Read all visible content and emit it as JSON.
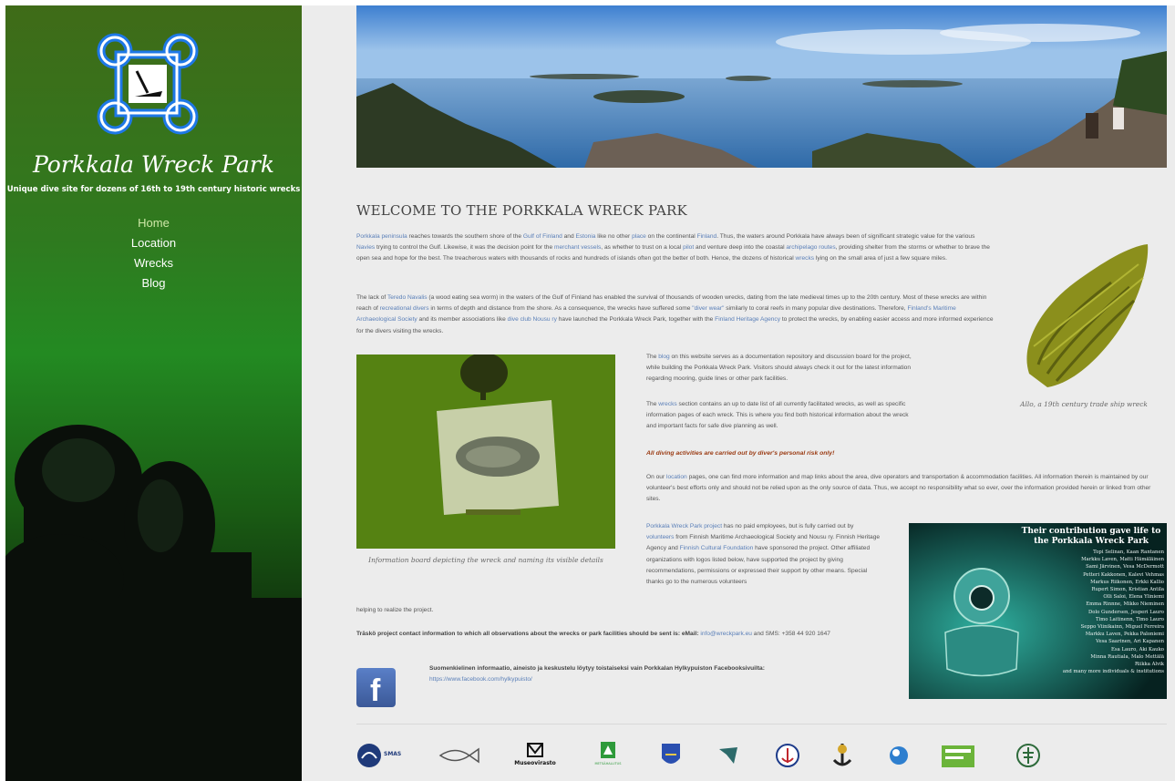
{
  "site": {
    "title": "Porkkala Wreck Park",
    "tagline": "Unique dive site for dozens of 16th to 19th century historic wrecks"
  },
  "nav": {
    "items": [
      {
        "label": "Home"
      },
      {
        "label": "Location"
      },
      {
        "label": "Wrecks"
      },
      {
        "label": "Blog"
      }
    ]
  },
  "main": {
    "heading": "WELCOME TO THE PORKKALA WRECK PARK",
    "p1": {
      "link1": "Porkkala peninsula",
      "t1": " reaches towards the southern shore of the ",
      "link2": "Gulf of Finland",
      "t2": " and ",
      "link3": "Estonia",
      "t3": " like no other ",
      "link4": "place",
      "t4": " on the continental ",
      "link5": "Finland",
      "t5": ". Thus, the waters around Porkkala have always been of significant strategic value for the various ",
      "link6": "Navies",
      "t6": " trying to control the Gulf. Likewise, it was the decision point for the ",
      "link7": "merchant vessels",
      "t7": ", as whether to trust on a local ",
      "link8": "pilot",
      "t8": " and venture deep into the coastal ",
      "link9": "archipelago routes",
      "t9": ", providing shelter from the storms or whether to brave the open sea and hope for the best. The treacherous waters with thousands of rocks and hundreds of islands often got the better of both. Hence, the dozens of historical ",
      "link10": "wrecks",
      "t10": " lying on the small area of just a few square miles."
    },
    "p2": {
      "t0": "The lack of ",
      "link1": "Teredo Navalis",
      "t1": " (a wood eating sea worm) in the waters of the Gulf of Finland has enabled the survival of thousands of wooden wrecks, dating from the late medieval times up to the 20th century. Most of these wrecks are within reach of ",
      "link2": "recreational divers",
      "t2": " in terms of depth and distance from the shore. As a consequence, the wrecks have suffered some ",
      "link3": "\"diver wear\"",
      "t3": " similarly to coral reefs in many popular dive destinations. Therefore, ",
      "link4": "Finland's Maritime Archaeological Society",
      "t4": " and its member associations like ",
      "link5": "dive club Nousu ry",
      "t5": " have launched the Porkkala Wreck Park, together with the ",
      "link6": "Finland Heritage Agency",
      "t6": " to protect the wrecks, by enabling easier access and more informed experience for the divers visiting the wrecks."
    },
    "ship_caption": "Allo, a 19th century trade ship wreck",
    "board_caption": "Information board depicting the wreck and naming its visible details",
    "p3": {
      "t0": "The ",
      "link1": "blog",
      "t1": " on this website serves as a documentation repository and discussion board for the project, while building the Porkkala Wreck Park. Visitors should always check it out for the latest information regarding mooring, guide lines or other park facilities."
    },
    "p4": {
      "t0": "The ",
      "link1": "wrecks",
      "t1": " section contains an up to date list of all currently facilitated wrecks, as well as specific information pages of each wreck. This is where you find both historical information about the wreck and important facts for safe dive planning as well."
    },
    "warning": "All diving activities are carried out by diver's personal risk only!",
    "p5": {
      "t0": "On our ",
      "link1": "location",
      "t1": " pages, one can find more information and map links about the area, dive operators and transportation & accommodation facilities. All information therein is maintained by our volunteer's best efforts only and should not be relied upon as the only source of data. Thus, we accept no responsibility what so ever, over the information provided herein or linked from other sites."
    },
    "p6": {
      "link1": "Porkkala Wreck Park project",
      "t1": " has no paid employees, but is fully carried out by ",
      "link2": "volunteers",
      "t2": " from Finnish Maritime Archaeological Society and Nousu ry. Finnish Heritage Agency and ",
      "link3": "Finnish Cultural Foundation",
      "t3": " have sponsored the project. Other affiliated organizations with logos listed below, have supported the project by giving recommendations, permissions or expressed their support by other means. Special thanks go to the numerous volunteers",
      "t4": "helping to realize the project."
    },
    "contact": {
      "t0": "Träskö project contact information to which all observations about the wrecks or park facilities should be sent is: eMail: ",
      "email": "info@wreckpark.eu",
      "t1": " and SMS: +358 44 920 1647"
    },
    "facebook": {
      "text": "Suomenkielinen informaatio, aineisto ja keskustelu löytyy toistaiseksi vain Porkkalan Hylkypuiston Facebooksivuilta:",
      "link": "https://www.facebook.com/hylkypuisto/",
      "icon_letter": "f"
    },
    "thanks": {
      "title": "Their contribution gave life to the Porkkala Wreck Park",
      "names": [
        "Topi Selinan, Kaan Rantanen",
        "Markku Laven, Matti Hämäläinen",
        "Sami Järvinen, Vesa McDermott",
        "Petteri Kakkonen, Kalevi Vehmas",
        "Markus Riikonen, Erkki Kallio",
        "Rupert Simon, Kristian Antila",
        "Olli Saloi, Elena Yliniemi",
        "Emma Rinnne, Mikko Nieminen",
        "Dolo Gundersen, Jesperi Lauro",
        "Timo Laitinenn, Timo Lauro",
        "Seppo Viinikainn, Miguel Ferreira",
        "Markku Laven, Pekka Paloniemi",
        "Vesa Saarinen, Ari Kapanen",
        "Esa Lauro, Aki Kauko",
        "Minna Rautiala, Malo Mettälä",
        "Riikka Alvik",
        "and many more individuals & institutions"
      ]
    },
    "logos": [
      {
        "label": "SMAS"
      },
      {
        "label": ""
      },
      {
        "label": "Museovirasto"
      },
      {
        "label": "METSÄHALLITUS"
      },
      {
        "label": ""
      },
      {
        "label": ""
      },
      {
        "label": ""
      },
      {
        "label": ""
      },
      {
        "label": ""
      },
      {
        "label": ""
      },
      {
        "label": ""
      }
    ]
  },
  "colors": {
    "link": "#5a7fb8",
    "warning": "#9a3a12",
    "sidebar_green": "#238a22",
    "logo_blue": "#2a7fe0"
  }
}
